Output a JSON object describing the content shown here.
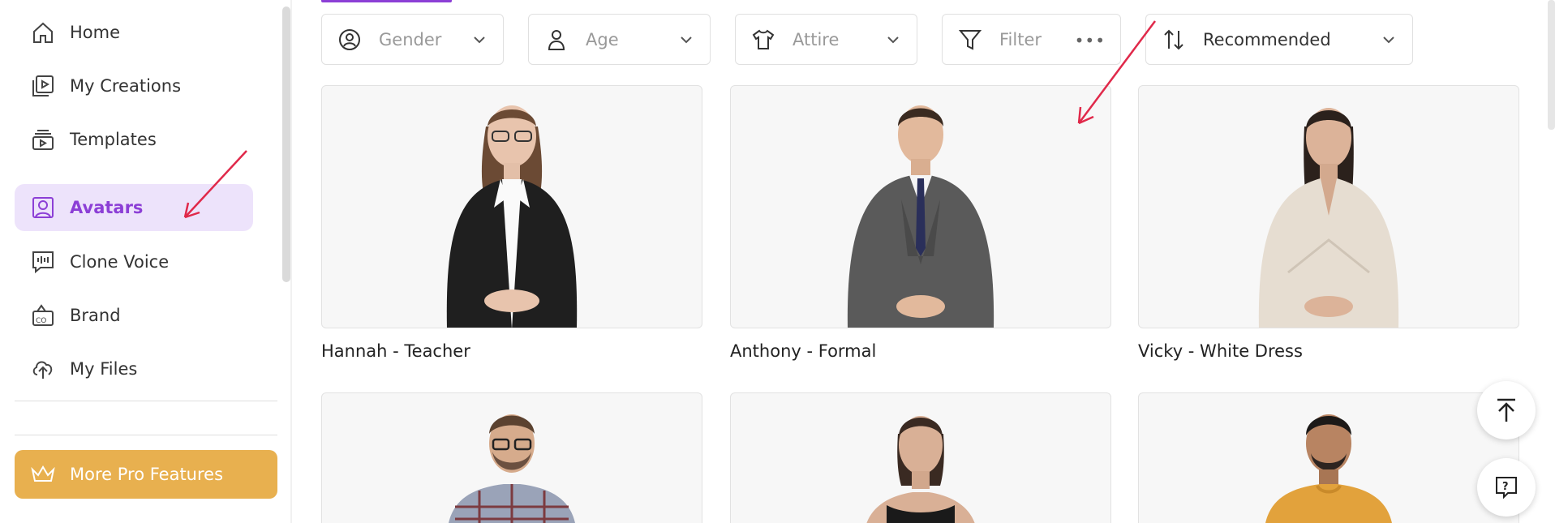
{
  "sidebar": {
    "items": [
      {
        "label": "Home",
        "icon": "home-icon"
      },
      {
        "label": "My Creations",
        "icon": "creations-icon"
      },
      {
        "label": "Templates",
        "icon": "templates-icon"
      },
      {
        "label": "Avatars",
        "icon": "avatar-icon",
        "active": true
      },
      {
        "label": "Clone Voice",
        "icon": "voice-icon"
      },
      {
        "label": "Brand",
        "icon": "brand-icon"
      },
      {
        "label": "My Files",
        "icon": "upload-icon"
      }
    ],
    "pro_button": "More Pro Features"
  },
  "filters": {
    "gender": "Gender",
    "age": "Age",
    "attire": "Attire",
    "filter": "Filter",
    "sort": "Recommended"
  },
  "avatars": [
    {
      "name": "Hannah - Teacher"
    },
    {
      "name": "Anthony - Formal"
    },
    {
      "name": "Vicky - White Dress"
    },
    {
      "name": ""
    },
    {
      "name": ""
    },
    {
      "name": ""
    }
  ],
  "colors": {
    "accent": "#8c3fd6",
    "active_bg": "#ede3fb",
    "pro": "#e8b04f",
    "annotation_arrow": "#e0294a"
  }
}
